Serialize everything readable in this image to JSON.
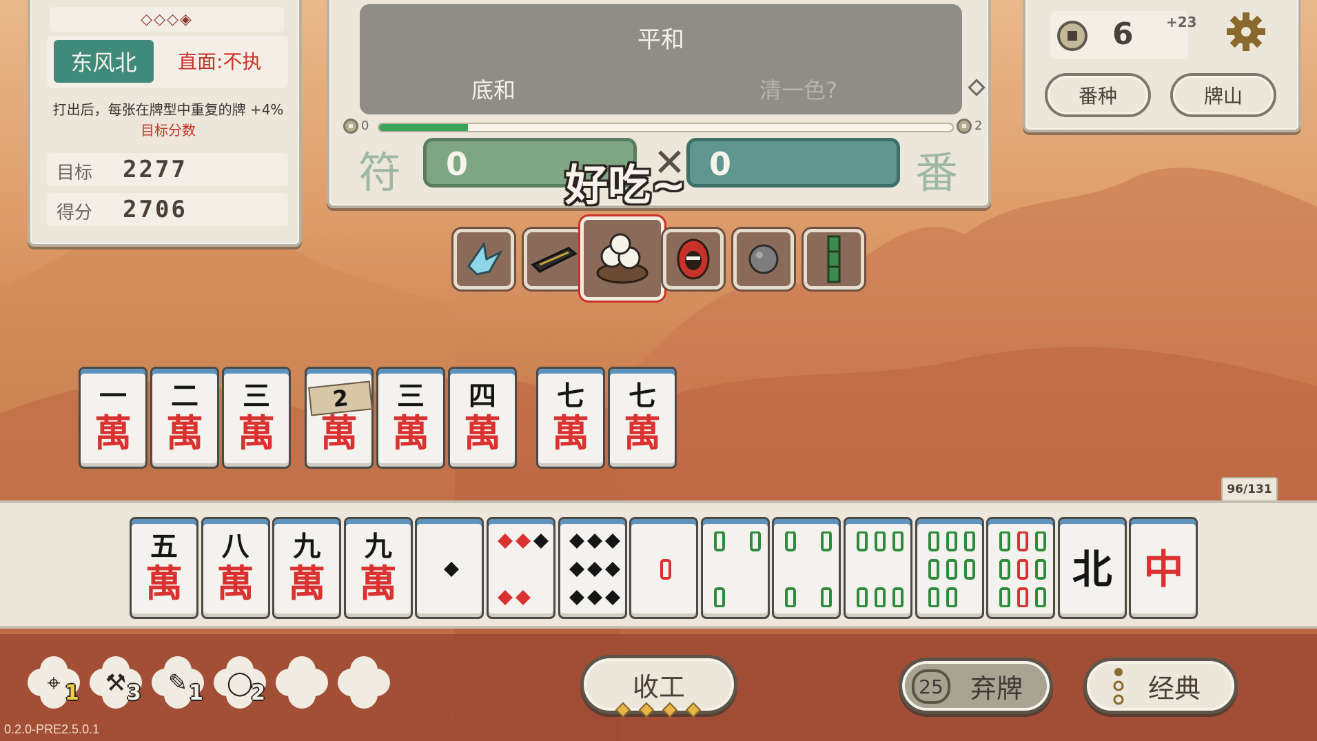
{
  "left_panel": {
    "ornament": "◇◇◇◈",
    "round_wind": "东风北",
    "boss_blind": "直面:不执",
    "description_main": "打出后，每张在牌型中重复的牌 +4%",
    "description_highlight": "目标分数",
    "target_label": "目标",
    "target_value": "2277",
    "score_label": "得分",
    "score_value": "2706"
  },
  "score_panel": {
    "hand_name": "平和",
    "base_hand": "底和",
    "possible_hand": "清一色?",
    "progress_start": "0",
    "progress_end": "2",
    "progress_fraction": 0.155,
    "fu_label": "符",
    "fu_value": "0",
    "multiply": "✕",
    "fan_label": "番",
    "fan_value": "0",
    "popup_text": "好吃~"
  },
  "right_panel": {
    "money": "6",
    "money_plus": "+23",
    "yaku_button": "番种",
    "wall_button": "牌山"
  },
  "relics": [
    {
      "name": "paper-crane",
      "color": "#8fd6e8"
    },
    {
      "name": "ink-stick",
      "color": "#2c2c2c"
    },
    {
      "name": "dumplings",
      "color": "#f5f2ea",
      "selected": true
    },
    {
      "name": "red-mask",
      "color": "#c8322a"
    },
    {
      "name": "stone",
      "color": "#7d7d7d"
    },
    {
      "name": "bamboo-stick",
      "color": "#3f8a4f"
    }
  ],
  "melds": [
    {
      "top": "一",
      "suit": "萬"
    },
    {
      "top": "二",
      "suit": "萬"
    },
    {
      "top": "三",
      "suit": "萬"
    },
    {
      "top": "2",
      "suit": "萬",
      "dora": true
    },
    {
      "top": "三",
      "suit": "萬"
    },
    {
      "top": "四",
      "suit": "萬"
    },
    {
      "top": "七",
      "suit": "萬"
    },
    {
      "top": "七",
      "suit": "萬"
    }
  ],
  "hand": [
    {
      "top": "五",
      "suit": "萬"
    },
    {
      "top": "八",
      "suit": "萬"
    },
    {
      "top": "九",
      "suit": "萬"
    },
    {
      "top": "九",
      "suit": "萬"
    },
    {
      "kind": "circle",
      "count": 1
    },
    {
      "kind": "circle",
      "count": 5
    },
    {
      "kind": "circle",
      "count": 9
    },
    {
      "kind": "bamboo",
      "count": 1
    },
    {
      "kind": "bamboo",
      "count": 3
    },
    {
      "kind": "bamboo",
      "count": 4
    },
    {
      "kind": "bamboo",
      "count": 6
    },
    {
      "kind": "bamboo",
      "count": 8
    },
    {
      "kind": "bamboo",
      "count": 9
    },
    {
      "honor": "北",
      "color": "#151515"
    },
    {
      "honor": "中",
      "color": "#d93230"
    }
  ],
  "wall_count": "96/131",
  "tools": [
    {
      "name": "hairdryer",
      "count": "1",
      "highlight": true
    },
    {
      "name": "shovel",
      "count": "3"
    },
    {
      "name": "brush",
      "count": "1"
    },
    {
      "name": "egg",
      "count": "2"
    },
    {
      "name": "empty",
      "count": ""
    },
    {
      "name": "empty",
      "count": ""
    }
  ],
  "buttons": {
    "finish": "收工",
    "discard": "弃牌",
    "discard_count": "25",
    "classic": "经典"
  },
  "version": "0.2.0-PRE2.5.0.1"
}
